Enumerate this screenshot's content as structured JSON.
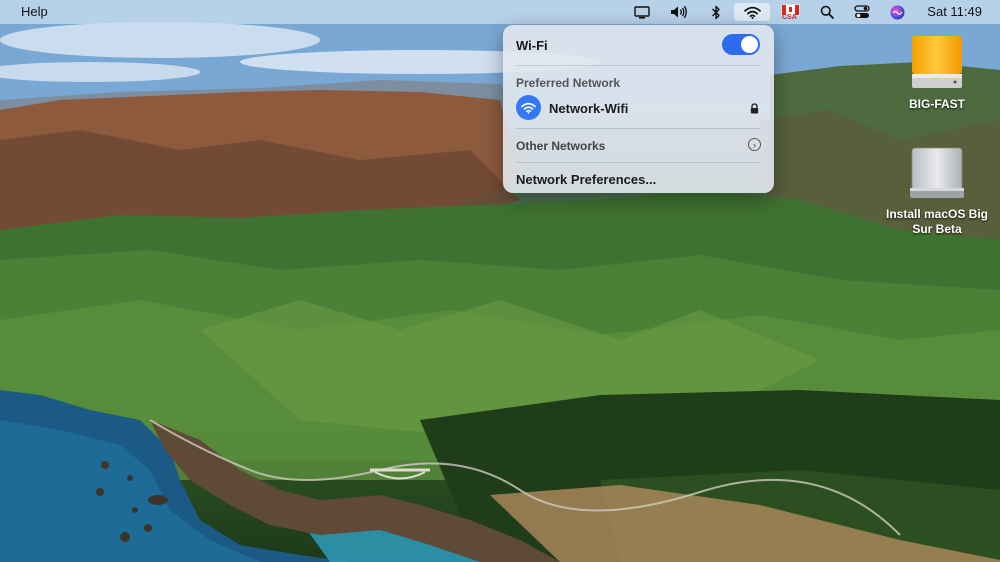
{
  "menubar": {
    "apple_fragment": "",
    "help_label": "Help",
    "clock": "Sat 11:49",
    "keyboard_flag_label": "CSA",
    "icons": [
      "display-icon",
      "volume-icon",
      "bluetooth-icon",
      "wifi-icon",
      "keyboard-flag-icon",
      "spotlight-search-icon",
      "control-center-icon",
      "siri-icon"
    ]
  },
  "wifi_panel": {
    "title": "Wi-Fi",
    "toggle_on": true,
    "preferred_label": "Preferred Network",
    "network_name": "Network-Wifi",
    "other_networks_label": "Other Networks",
    "preferences_label": "Network Preferences..."
  },
  "desktop_icons": [
    {
      "name": "BIG-FAST"
    },
    {
      "name": "Install macOS Big Sur Beta"
    }
  ],
  "colors": {
    "accent": "#2f6bf0",
    "network_icon": "#3478f6"
  }
}
